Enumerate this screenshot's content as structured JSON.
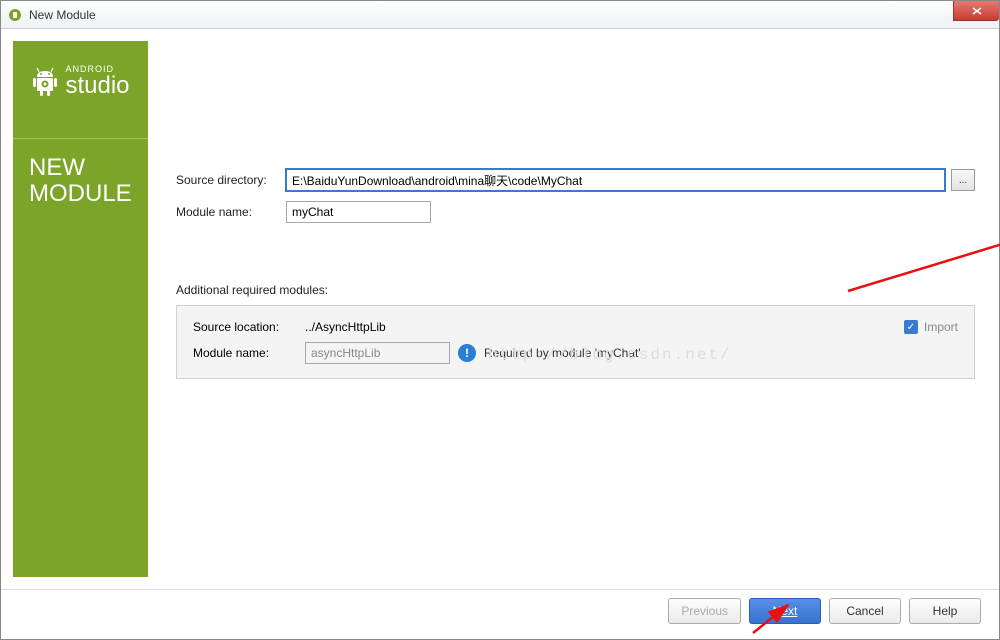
{
  "window": {
    "title": "New Module"
  },
  "sidebar": {
    "brand_small": "ANDROID",
    "brand_large": "studio",
    "title_line1": "NEW",
    "title_line2": "MODULE"
  },
  "form": {
    "source_directory_label": "Source directory:",
    "source_directory_value": "E:\\BaiduYunDownload\\android\\mina聊天\\code\\MyChat",
    "module_name_label": "Module name:",
    "module_name_value": "myChat",
    "browse_label": "..."
  },
  "required": {
    "section_title": "Additional required modules:",
    "source_location_label": "Source location:",
    "source_location_value": "../AsyncHttpLib",
    "module_name_label": "Module name:",
    "module_name_value": "asyncHttpLib",
    "import_label": "Import",
    "required_by_text": "Required by module 'myChat'"
  },
  "watermark": "http://blog.csdn.net/",
  "footer": {
    "previous": "Previous",
    "next": "Next",
    "cancel": "Cancel",
    "help": "Help"
  }
}
